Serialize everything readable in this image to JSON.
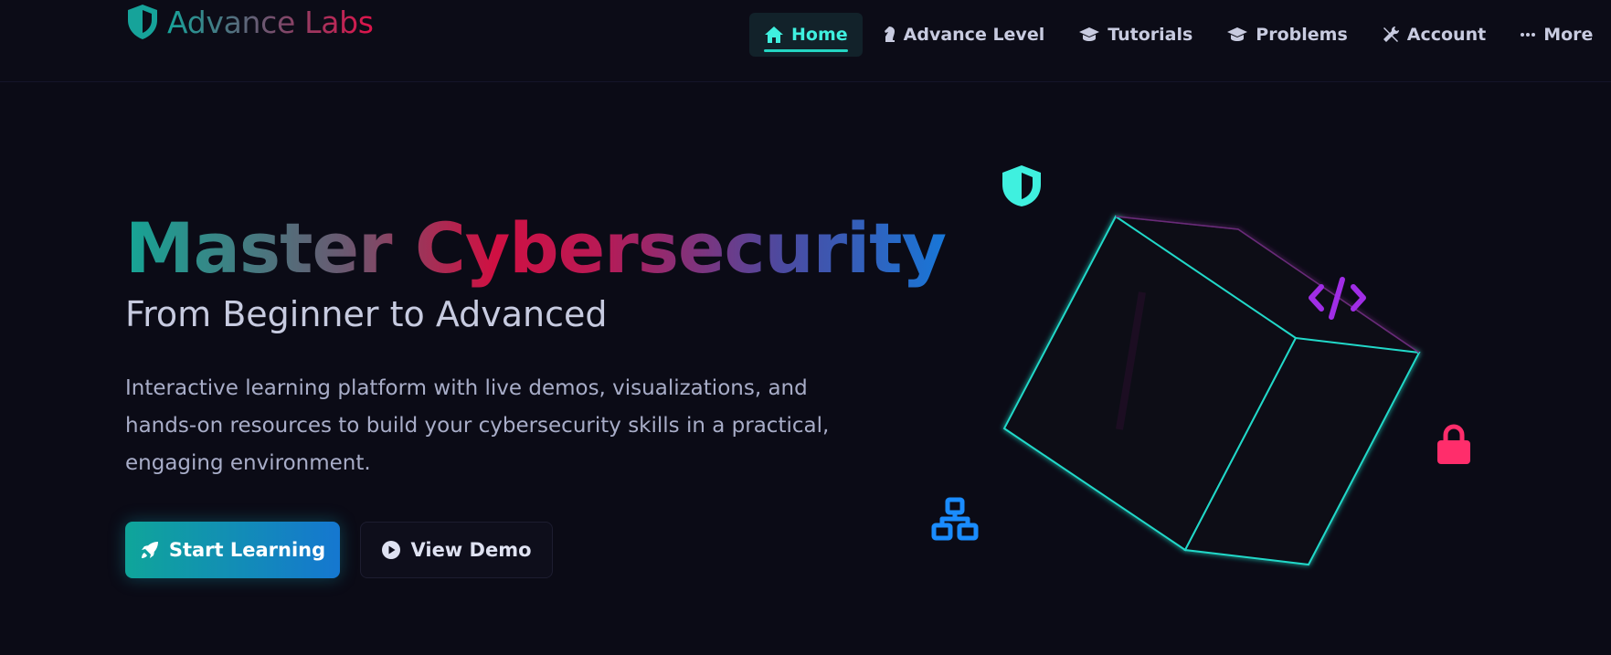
{
  "brand": {
    "name": "Advance Labs",
    "icon": "shield-icon"
  },
  "nav": {
    "items": [
      {
        "label": "Home",
        "icon": "home-icon",
        "active": true
      },
      {
        "label": "Advance Level",
        "icon": "chess-knight-icon"
      },
      {
        "label": "Tutorials",
        "icon": "graduation-cap-icon"
      },
      {
        "label": "Problems",
        "icon": "graduation-cap-icon"
      },
      {
        "label": "Account",
        "icon": "tools-icon"
      },
      {
        "label": "More",
        "icon": "ellipsis-icon"
      }
    ]
  },
  "hero": {
    "title": "Master Cybersecurity",
    "subtitle": "From Beginner to Advanced",
    "description": "Interactive learning platform with live demos, visualizations, and hands-on resources to build your cybersecurity skills in a practical, engaging environment.",
    "primary_cta": "Start Learning",
    "secondary_cta": "View Demo",
    "floating_icons": [
      "shield-icon",
      "code-icon",
      "lock-icon",
      "network-icon"
    ]
  },
  "colors": {
    "background": "#0b0b16",
    "accent_teal": "#3ff0df",
    "accent_pink": "#ff2d6b",
    "accent_purple": "#a02de6",
    "accent_blue": "#1a8cff"
  }
}
